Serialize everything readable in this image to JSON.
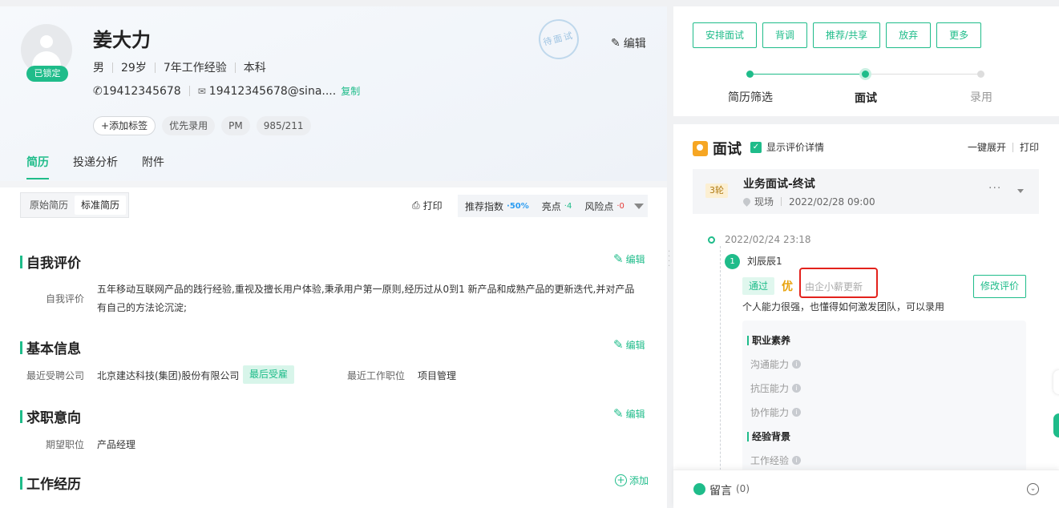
{
  "candidate": {
    "name": "姜大力",
    "locked_badge": "已锁定",
    "gender": "男",
    "age": "29岁",
    "experience": "7年工作经验",
    "education": "本科",
    "phone": "19412345678",
    "email": "19412345678@sina....",
    "copy_label": "复制",
    "add_tag_label": "添加标签",
    "tags": [
      "优先录用",
      "PM",
      "985/211"
    ],
    "stamp_text": "待面试",
    "edit_label": "编辑"
  },
  "tabs": [
    "简历",
    "投递分析",
    "附件"
  ],
  "resume_toolbar": {
    "segments": [
      "原始简历",
      "标准简历"
    ],
    "print_label": "打印",
    "score_label": "推荐指数",
    "score_value": "·50%",
    "highlight_label": "亮点",
    "highlight_value": "·4",
    "risk_label": "风险点",
    "risk_value": "·0"
  },
  "sections": {
    "self_eval": {
      "title": "自我评价",
      "edit": "编辑",
      "label": "自我评价",
      "line1": "五年移动互联网产品的践行经验,重视及擅长用户体验,秉承用户第一原则,经历过从0到1  新产品和成熟产品的更新迭代,并对产品",
      "line2": "有自己的方法论沉淀;"
    },
    "basic": {
      "title": "基本信息",
      "edit": "编辑",
      "company_label": "最近受聘公司",
      "company": "北京建达科技(集团)股份有限公司",
      "company_tag": "最后受雇",
      "position_label": "最近工作职位",
      "position": "项目管理"
    },
    "intent": {
      "title": "求职意向",
      "edit": "编辑",
      "label": "期望职位",
      "value": "产品经理"
    },
    "work": {
      "title": "工作经历",
      "add": "添加"
    }
  },
  "actions": [
    "安排面试",
    "背调",
    "推荐/共享",
    "放弃",
    "更多"
  ],
  "steps": [
    "简历筛选",
    "面试",
    "录用"
  ],
  "interview": {
    "title": "面试",
    "show_detail_label": "显示评价详情",
    "expand_label": "一键展开",
    "print_label": "打印",
    "round_badge": "3轮",
    "round_name": "业务面试-终试",
    "location": "现场",
    "datetime": "2022/02/28 09:00",
    "record_date": "2022/02/24 23:18",
    "interviewer_no": "1",
    "interviewer": "刘辰辰1",
    "result": "通过",
    "grade": "优",
    "note": "由企小薪更新",
    "modify_label": "修改评价",
    "comment": "个人能力很强，也懂得如何激发团队，可以录用",
    "groups": [
      {
        "title": "职业素养",
        "items": [
          "沟通能力",
          "抗压能力",
          "协作能力"
        ]
      },
      {
        "title": "经验背景",
        "items": [
          "工作经验"
        ]
      }
    ]
  },
  "footer": {
    "label": "留言",
    "count": "(0)"
  }
}
